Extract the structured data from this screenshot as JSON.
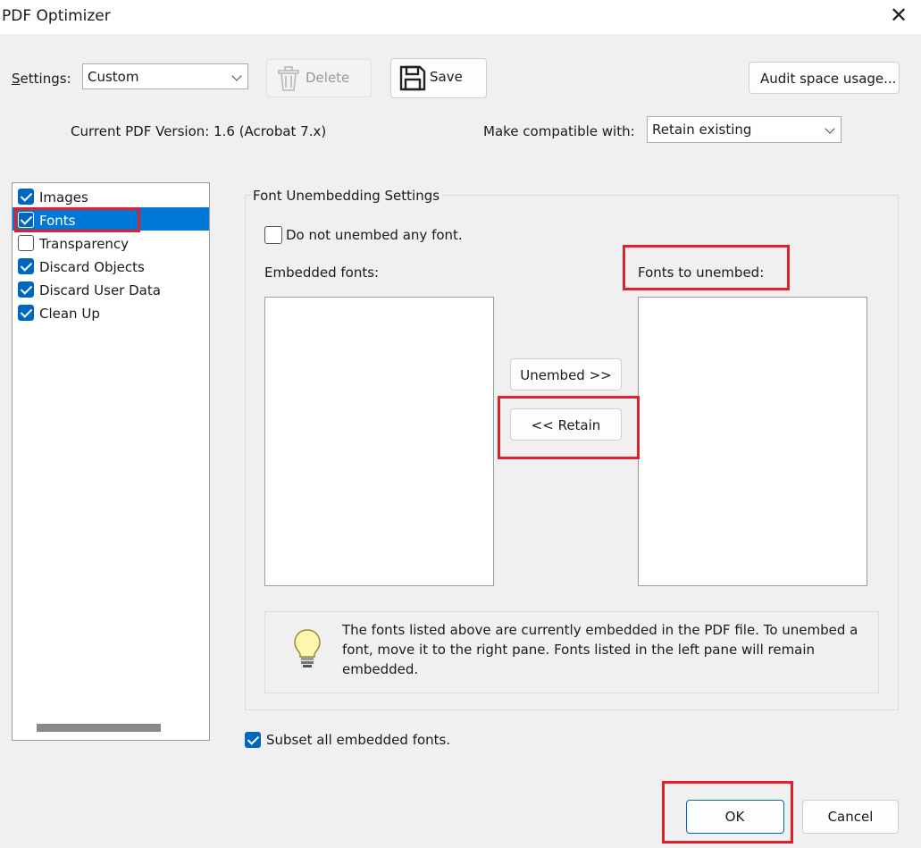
{
  "window": {
    "title": "PDF Optimizer",
    "close_icon": "close-icon"
  },
  "settings": {
    "label": "Settings:",
    "value": "Custom"
  },
  "toolbar": {
    "delete_label": "Delete",
    "save_label": "Save",
    "audit_label": "Audit space usage..."
  },
  "version_text": "Current PDF Version: 1.6 (Acrobat 7.x)",
  "compat": {
    "label": "Make compatible with:",
    "value": "Retain existing"
  },
  "categories": [
    {
      "label": "Images",
      "checked": true
    },
    {
      "label": "Fonts",
      "checked": true,
      "selected": true
    },
    {
      "label": "Transparency",
      "checked": false
    },
    {
      "label": "Discard Objects",
      "checked": true
    },
    {
      "label": "Discard User Data",
      "checked": true
    },
    {
      "label": "Clean Up",
      "checked": true
    }
  ],
  "fonts_panel": {
    "group_title": "Font Unembedding Settings",
    "do_not_unembed_label": "Do not unembed any font.",
    "embedded_label": "Embedded fonts:",
    "unembed_label": "Fonts to unembed:",
    "unembed_button": "Unembed >>",
    "retain_button": "<< Retain",
    "info_text": "The fonts listed above are currently embedded in the PDF file. To unembed a font, move it to the right pane. Fonts listed in the left pane will remain embedded."
  },
  "subset_label": "Subset all embedded fonts.",
  "footer": {
    "ok_label": "OK",
    "cancel_label": "Cancel"
  },
  "colors": {
    "accent": "#0067c0",
    "highlight": "#e0202a"
  }
}
